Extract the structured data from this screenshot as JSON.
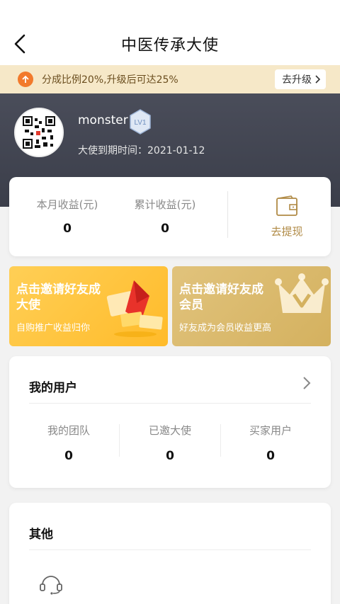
{
  "header": {
    "title": "中医传承大使",
    "back_icon": "chevron-left-icon"
  },
  "upgrade": {
    "text": "分成比例20%,升级后可达25%",
    "button_label": "去升级",
    "icon": "arrow-up-icon",
    "accent": "#f27a2c"
  },
  "profile": {
    "username": "monster",
    "level": "LV1",
    "expire_text": "大使到期时间：2021-01-12"
  },
  "earnings": {
    "month_label": "本月收益(元)",
    "month_value": "0",
    "total_label": "累计收益(元)",
    "total_value": "0",
    "withdraw_label": "去提现",
    "withdraw_icon": "wallet-icon"
  },
  "banners": [
    {
      "title": "点击邀请好友成大使",
      "subtitle": "自购推广收益归你",
      "color": "#ffc33a"
    },
    {
      "title": "点击邀请好友成会员",
      "subtitle": "好友成为会员收益更高",
      "color": "#d9b86a"
    }
  ],
  "my_users": {
    "title": "我的用户",
    "stats": [
      {
        "label": "我的团队",
        "value": "0"
      },
      {
        "label": "已邀大使",
        "value": "0"
      },
      {
        "label": "买家用户",
        "value": "0"
      }
    ]
  },
  "other": {
    "title": "其他",
    "service_icon": "headset-icon"
  }
}
